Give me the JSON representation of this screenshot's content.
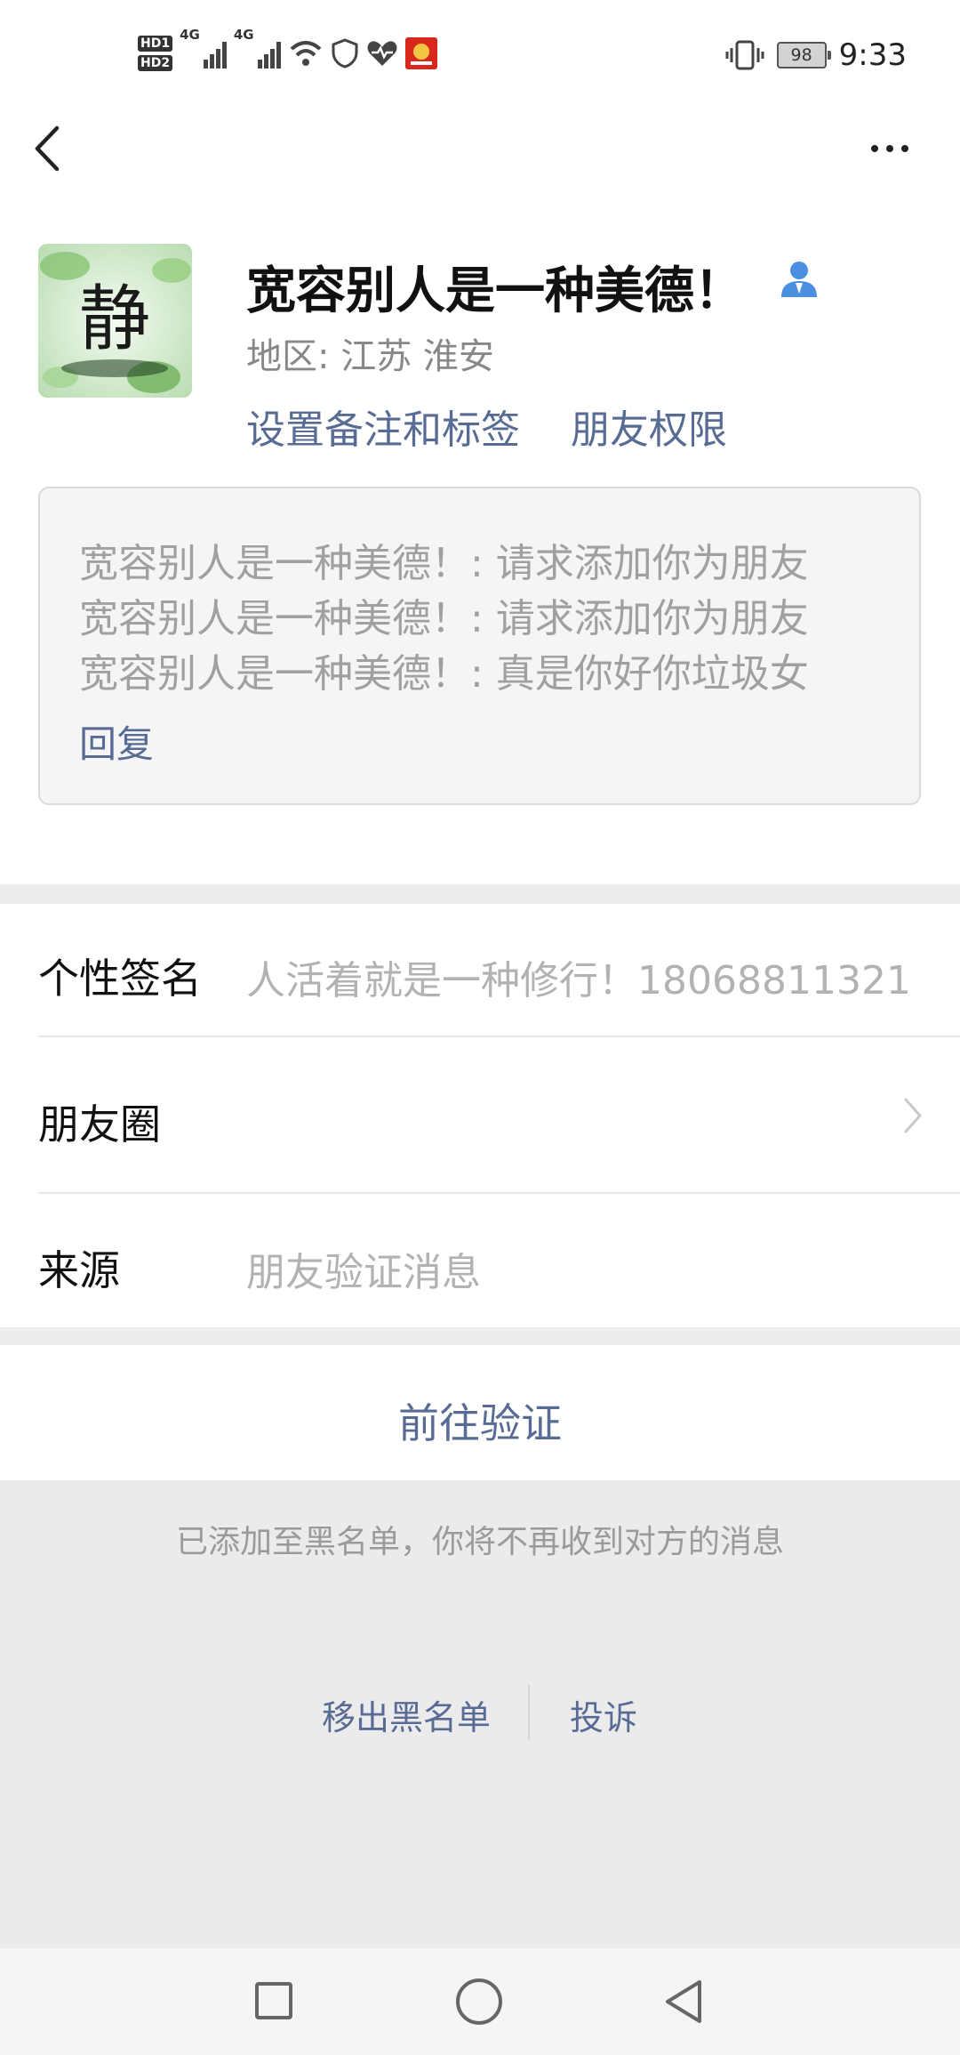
{
  "status_bar": {
    "left_badges": [
      "HD1",
      "HD2"
    ],
    "network_labels": [
      "4G",
      "4G"
    ],
    "battery": "98",
    "time": "9:33"
  },
  "nav": {
    "back_icon": "chevron-left-icon",
    "more_icon": "more-horizontal-icon"
  },
  "profile": {
    "name": "宽容别人是一种美德！",
    "region": "地区:  江苏  淮安",
    "set_remark_label": "设置备注和标签",
    "friend_permission_label": "朋友权限",
    "avatar_text": "静"
  },
  "messages": {
    "lines": [
      "宽容别人是一种美德！: 请求添加你为朋友",
      "宽容别人是一种美德！: 请求添加你为朋友",
      "宽容别人是一种美德！: 真是你好你垃圾女"
    ],
    "reply_label": "回复"
  },
  "rows": {
    "signature_label": "个性签名",
    "signature_value": "人活着就是一种修行！18068811321",
    "moments_label": "朋友圈",
    "source_label": "来源",
    "source_value": "朋友验证消息"
  },
  "actions": {
    "verify_label": "前往验证",
    "blacklist_notice": "已添加至黑名单，你将不再收到对方的消息",
    "remove_blacklist_label": "移出黑名单",
    "report_label": "投诉"
  },
  "colors": {
    "link": "#586b94",
    "gray_text": "#b2b2b2",
    "separator": "#ededed"
  }
}
